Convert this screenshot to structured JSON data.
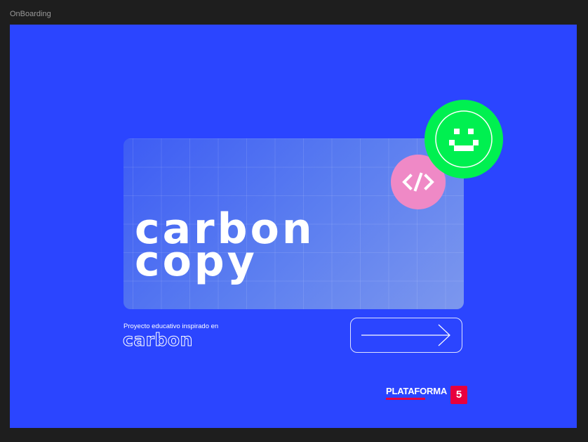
{
  "frame": {
    "label": "OnBoarding",
    "background_color": "#2b45ff"
  },
  "hero": {
    "title_line_1": "carbon",
    "title_line_2": "copy"
  },
  "badges": {
    "code_icon": "code-brackets-icon",
    "code_color": "#ef89c6",
    "smiley_icon": "pixel-smiley-icon",
    "smiley_color": "#00f050"
  },
  "footer": {
    "caption": "Proyecto educativo inspirado en",
    "brand": "carbon"
  },
  "next_button": {
    "icon": "arrow-right-icon"
  },
  "logo": {
    "text": "PLATAFORMA",
    "number": "5",
    "accent_color": "#e8003d"
  }
}
